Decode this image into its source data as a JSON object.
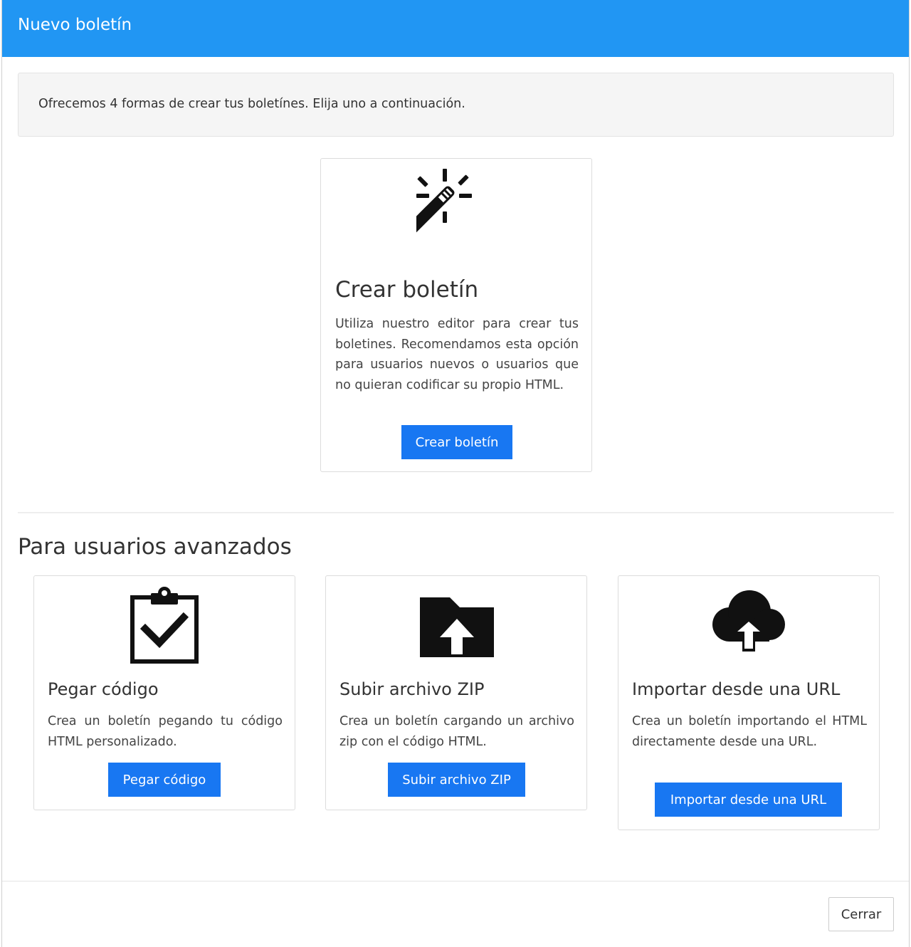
{
  "modal": {
    "title": "Nuevo boletín",
    "intro": "Ofrecemos 4 formas de crear tus boletínes. Elija uno a continuación.",
    "close_label": "Cerrar",
    "header_color": "#2196f3",
    "button_color": "#1877f2"
  },
  "main_option": {
    "icon": "magic-wand-icon",
    "title": "Crear boletín",
    "description": "Utiliza nuestro editor para crear tus boletines. Recomendamos esta opción para usuarios nuevos o usuarios que no quieran codificar su propio HTML.",
    "button_label": "Crear boletín"
  },
  "advanced": {
    "heading": "Para usuarios avanzados",
    "options": [
      {
        "icon": "clipboard-check-icon",
        "title": "Pegar código",
        "description": "Crea un boletín pegando tu código HTML personalizado.",
        "button_label": "Pegar código"
      },
      {
        "icon": "folder-upload-icon",
        "title": "Subir archivo ZIP",
        "description": "Crea un boletín cargando un archivo zip con el código HTML.",
        "button_label": "Subir archivo ZIP"
      },
      {
        "icon": "cloud-upload-icon",
        "title": "Importar desde una URL",
        "description": "Crea un boletín importando el HTML directamente desde una URL.",
        "button_label": "Importar desde una URL"
      }
    ]
  }
}
